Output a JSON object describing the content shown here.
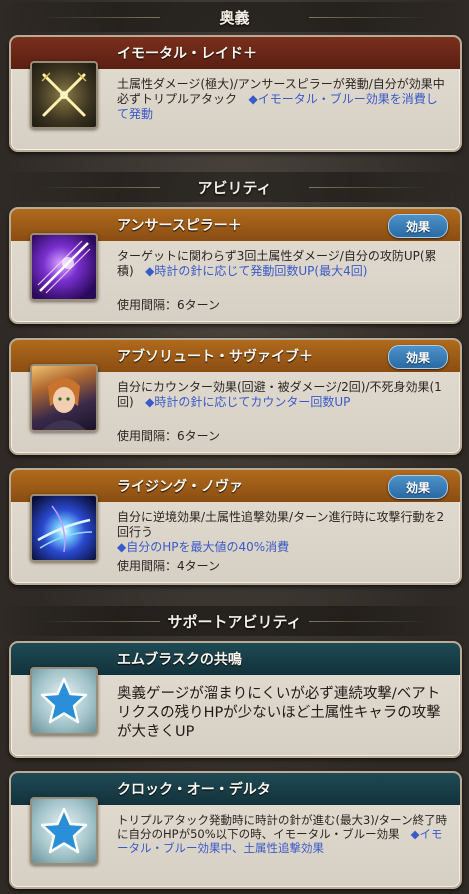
{
  "sections": {
    "ougi": "奥義",
    "ability": "アビリティ",
    "support": "サポートアビリティ"
  },
  "ougi": {
    "name": "イモータル・レイド＋",
    "desc_main": "土属性ダメージ(極大)/アンサースピラーが発動/自分が効果中必ずトリプルアタック",
    "desc_highlight": "◆イモータル・ブルー効果を消費して発動"
  },
  "abilities": [
    {
      "name": "アンサースピラー＋",
      "effect_label": "効果",
      "desc_main": "ターゲットに関わらず3回土属性ダメージ/自分の攻防UP(累積)",
      "desc_highlight": "◆時計の針に応じて発動回数UP(最大4回)",
      "cooldown": "使用間隔：6ターン"
    },
    {
      "name": "アブソリュート・サヴァイブ＋",
      "effect_label": "効果",
      "desc_main": "自分にカウンター効果(回避・被ダメージ/2回)/不死身効果(1回)",
      "desc_highlight": "◆時計の針に応じてカウンター回数UP",
      "cooldown": "使用間隔：6ターン"
    },
    {
      "name": "ライジング・ノヴァ",
      "effect_label": "効果",
      "desc_main": "自分に逆境効果/土属性追撃効果/ターン進行時に攻撃行動を2回行う",
      "desc_highlight": "◆自分のHPを最大値の40%消費",
      "cooldown": "使用間隔：4ターン"
    }
  ],
  "support": [
    {
      "name": "エムブラスクの共鳴",
      "desc_main": "奥義ゲージが溜まりにくいが必ず連続攻撃/ベアトリクスの残りHPが少ないほど土属性キャラの攻撃が大きくUP",
      "desc_highlight": ""
    },
    {
      "name": "クロック・オー・デルタ",
      "desc_main": "トリプルアタック発動時に時計の針が進む(最大3)/ターン終了時に自分のHPが50%以下の時、イモータル・ブルー効果",
      "desc_highlight": "◆イモータル・ブルー効果中、土属性追撃効果"
    }
  ],
  "colors": {
    "header_ougi": "#6a2818",
    "header_ability": "#9c5b17",
    "header_support": "#183e48",
    "highlight_text": "#3a5ac8",
    "effect_button": "#2f72b0"
  },
  "icons": {
    "ougi": "crossed-swords-icon",
    "ability_1": "purple-lance-icon",
    "ability_2": "character-portrait-icon",
    "ability_3": "blue-nova-icon",
    "support": "star-icon"
  }
}
